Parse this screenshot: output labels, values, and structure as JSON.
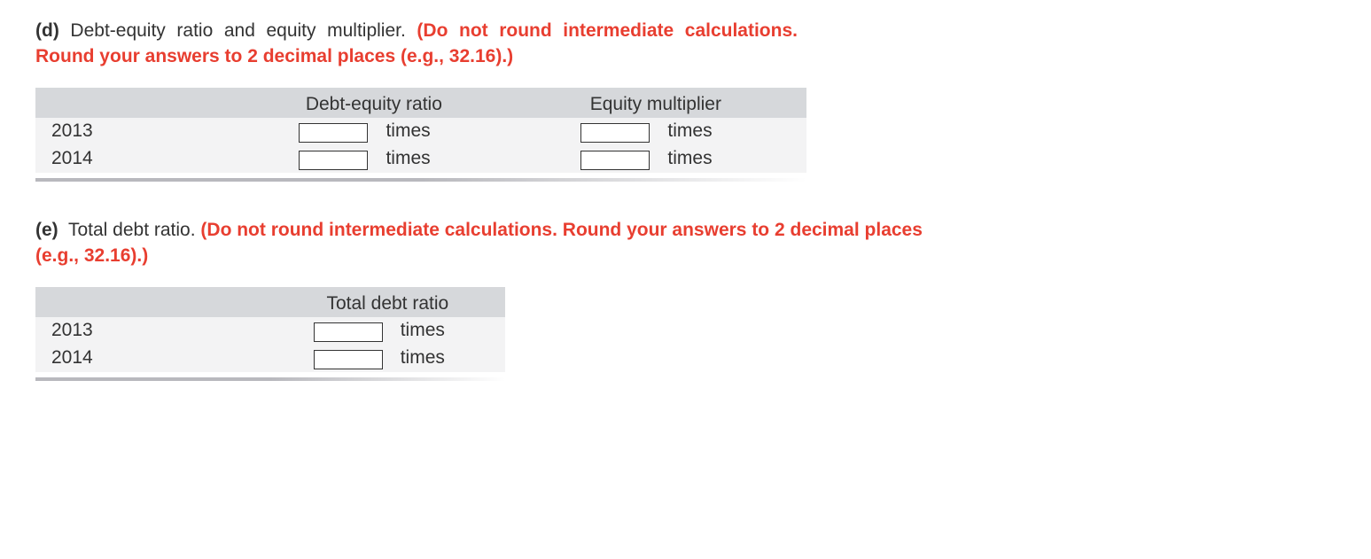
{
  "questions": {
    "d": {
      "label": "(d)",
      "text_plain": "Debt-equity ratio and equity multiplier.",
      "note": "(Do not round intermediate calculations. Round your answers to 2 decimal places (e.g., 32.16).)",
      "table": {
        "headers": [
          "Debt-equity ratio",
          "Equity multiplier"
        ],
        "rows": [
          {
            "year": "2013",
            "unit": "times"
          },
          {
            "year": "2014",
            "unit": "times"
          }
        ]
      }
    },
    "e": {
      "label": "(e)",
      "text_plain": "Total debt ratio.",
      "note": "(Do not round intermediate calculations. Round your answers to 2 decimal places (e.g., 32.16).)",
      "table": {
        "headers": [
          "Total debt ratio"
        ],
        "rows": [
          {
            "year": "2013",
            "unit": "times"
          },
          {
            "year": "2014",
            "unit": "times"
          }
        ]
      }
    }
  }
}
